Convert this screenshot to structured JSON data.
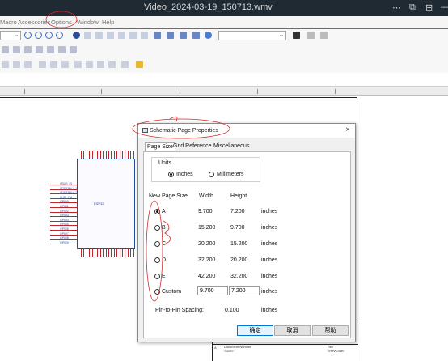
{
  "window": {
    "title": "Video_2024-03-19_150713.wmv",
    "controls": [
      "⋯",
      "⧉",
      "⊞",
      "—"
    ]
  },
  "menu": {
    "items": [
      "Macro",
      "Accessories",
      "Options",
      "Window",
      "Help"
    ]
  },
  "canvas": {
    "chip_pins_left": [
      "VBUS_IN",
      "VDD33PLL_1",
      "VDD33PLL_2",
      "CHIP_PU",
      "GPIO0",
      "GPIO1",
      "GPIO2",
      "GPIO3",
      "GPIO4",
      "GPIO5",
      "GPIO6",
      "GPIO7",
      "GPIO8",
      "GPIO9"
    ],
    "chip_label": "ESP32",
    "titleblock": {
      "size": "A",
      "doc_label": "Document Number",
      "doc_value": "<Doc>",
      "rev_label": "Rev",
      "rev_value": "<RevCode>",
      "title": "<Title>"
    }
  },
  "dialog": {
    "title": "Schematic Page Properties",
    "close": "×",
    "tabs": [
      "Page Size",
      "Grid Reference",
      "Miscellaneous"
    ],
    "units_label": "Units",
    "unit_inches": "Inches",
    "unit_mm": "Millimeters",
    "col_new_size": "New Page Size",
    "col_width": "Width",
    "col_height": "Height",
    "sizes": [
      {
        "name": "A",
        "width": "9.700",
        "height": "7.200",
        "unit": "inches",
        "selected": true
      },
      {
        "name": "B",
        "width": "15.200",
        "height": "9.700",
        "unit": "inches",
        "selected": false
      },
      {
        "name": "C",
        "width": "20.200",
        "height": "15.200",
        "unit": "inches",
        "selected": false
      },
      {
        "name": "D",
        "width": "32.200",
        "height": "20.200",
        "unit": "inches",
        "selected": false
      },
      {
        "name": "E",
        "width": "42.200",
        "height": "32.200",
        "unit": "inches",
        "selected": false
      }
    ],
    "custom": {
      "name": "Custom",
      "width": "9.700",
      "height": "7.200",
      "unit": "inches"
    },
    "pin_spacing_label": "Pin-to-Pin Spacing:",
    "pin_spacing_value": "0.100",
    "pin_spacing_unit": "inches",
    "ok": "确定",
    "cancel": "取消",
    "help": "帮助"
  }
}
